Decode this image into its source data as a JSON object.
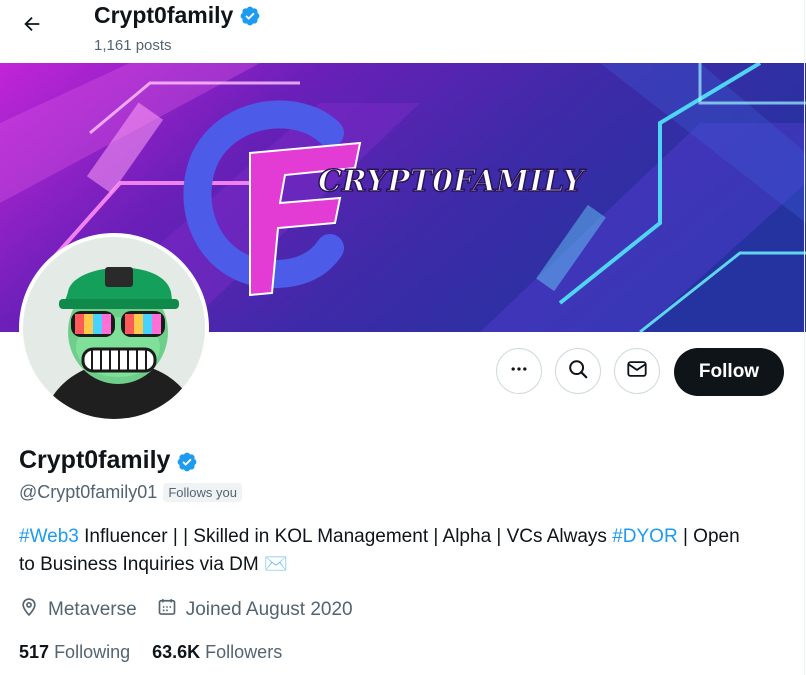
{
  "header": {
    "name": "Crypt0family",
    "posts": "1,161 posts"
  },
  "banner": {
    "wordmark": "CRYPT0FAMILY",
    "monogram": "CF"
  },
  "actions": {
    "follow_label": "Follow"
  },
  "profile": {
    "display_name": "Crypt0family",
    "handle": "@Crypt0family01",
    "follows_you": "Follows you",
    "bio": {
      "tag1": "#Web3",
      "text1": " Influencer | | Skilled in KOL Management | Alpha | VCs Always ",
      "tag2": "#DYOR",
      "text2": " | Open to Business Inquiries via DM ✉️"
    },
    "location": "Metaverse",
    "joined": "Joined August 2020",
    "following_count": "517",
    "following_label": "Following",
    "followers_count": "63.6K",
    "followers_label": "Followers"
  },
  "colors": {
    "accent": "#1d9bf0",
    "verified": "#1d9bf0",
    "text_primary": "#0f1419",
    "text_secondary": "#536471",
    "follow_bg": "#0f1419"
  }
}
